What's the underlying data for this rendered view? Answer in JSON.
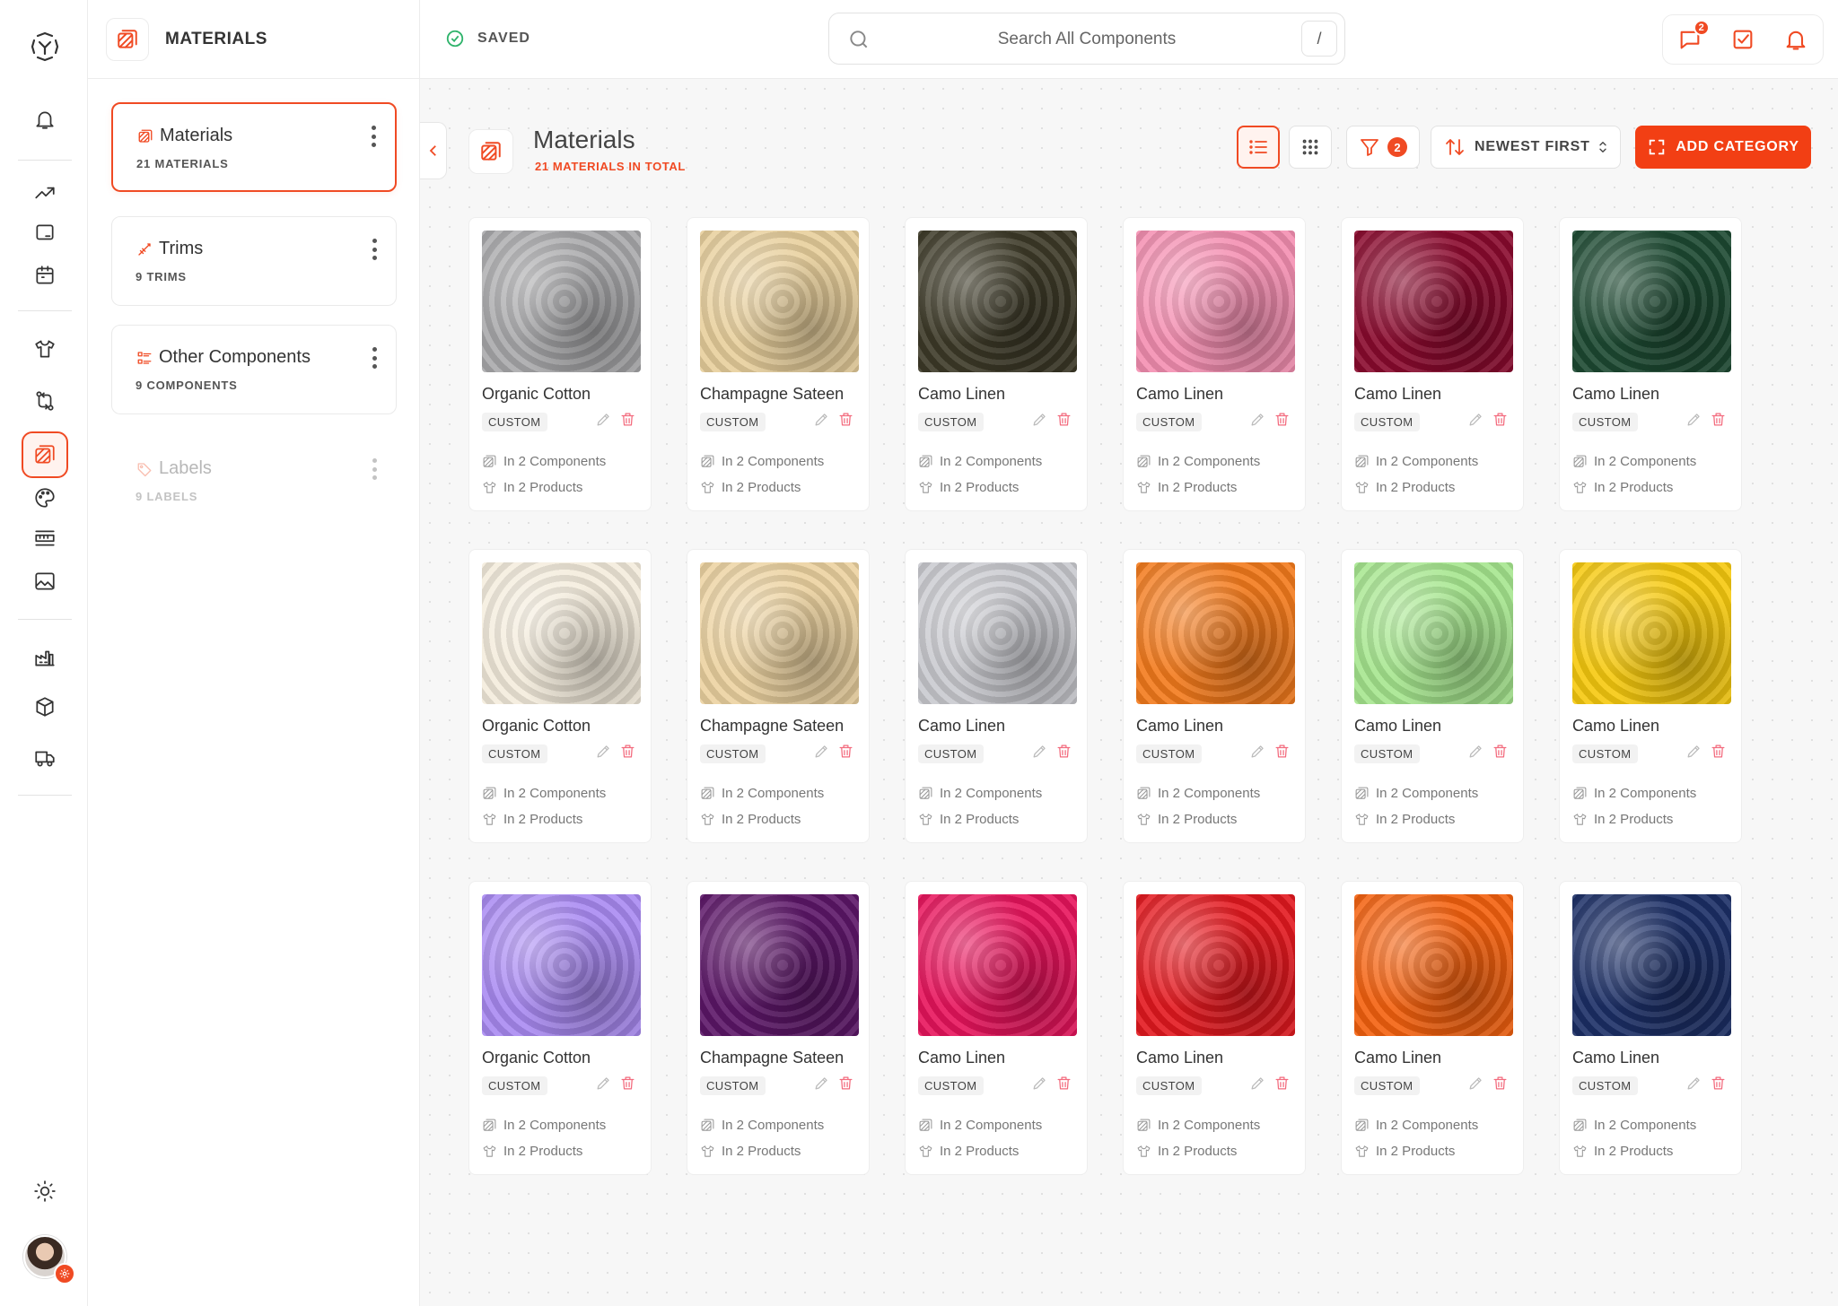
{
  "colors": {
    "accent": "#f04a23",
    "success": "#2fb36b",
    "delete": "#f36b7e"
  },
  "rail": {
    "icons": [
      "logo-icon",
      "bell-icon",
      "trend-icon",
      "monitor-icon",
      "calendar-icon",
      "tshirt-icon",
      "transfer-icon",
      "materials-icon",
      "palette-icon",
      "ruler-icon",
      "image-icon",
      "factory-icon",
      "box-icon",
      "truck-icon",
      "sun-icon"
    ],
    "active": "materials-icon"
  },
  "category_panel": {
    "title": "MATERIALS",
    "categories": [
      {
        "name": "Materials",
        "count": "21 MATERIALS",
        "icon": "materials-icon",
        "state": "active"
      },
      {
        "name": "Trims",
        "count": "9 TRIMS",
        "icon": "needle-icon",
        "state": "normal"
      },
      {
        "name": "Other Components",
        "count": "9 COMPONENTS",
        "icon": "list-icon",
        "state": "normal"
      },
      {
        "name": "Labels",
        "count": "9 LABELS",
        "icon": "tag-icon",
        "state": "disabled"
      }
    ]
  },
  "topbar": {
    "status": "SAVED",
    "search_placeholder": "Search All Components",
    "search_shortcut": "/",
    "message_badge": "2"
  },
  "main": {
    "title": "Materials",
    "subtitle": "21 MATERIALS IN TOTAL",
    "filter_count": "2",
    "sort_label": "NEWEST FIRST",
    "add_label": "ADD CATEGORY"
  },
  "card_labels": {
    "tag": "CUSTOM",
    "components": "In 2 Components",
    "products": "In 2 Products"
  },
  "materials": [
    {
      "name": "Organic Cotton",
      "color": "#a9a9ab"
    },
    {
      "name": "Champagne Sateen",
      "color": "#e8cf9c"
    },
    {
      "name": "Camo Linen",
      "color": "#3d3a28"
    },
    {
      "name": "Camo Linen",
      "color": "#f48fb1"
    },
    {
      "name": "Camo Linen",
      "color": "#8a0a2e"
    },
    {
      "name": "Camo Linen",
      "color": "#1d4a32"
    },
    {
      "name": "Organic Cotton",
      "color": "#f4ecdc"
    },
    {
      "name": "Champagne Sateen",
      "color": "#ecd2a0"
    },
    {
      "name": "Camo Linen",
      "color": "#c9cacf"
    },
    {
      "name": "Camo Linen",
      "color": "#f37a1c"
    },
    {
      "name": "Camo Linen",
      "color": "#a6e68e"
    },
    {
      "name": "Camo Linen",
      "color": "#f6c90e"
    },
    {
      "name": "Organic Cotton",
      "color": "#a98af2"
    },
    {
      "name": "Champagne Sateen",
      "color": "#5c1668"
    },
    {
      "name": "Camo Linen",
      "color": "#e8145c"
    },
    {
      "name": "Camo Linen",
      "color": "#e3191f"
    },
    {
      "name": "Camo Linen",
      "color": "#f4610e"
    },
    {
      "name": "Camo Linen",
      "color": "#1c2f66"
    }
  ]
}
